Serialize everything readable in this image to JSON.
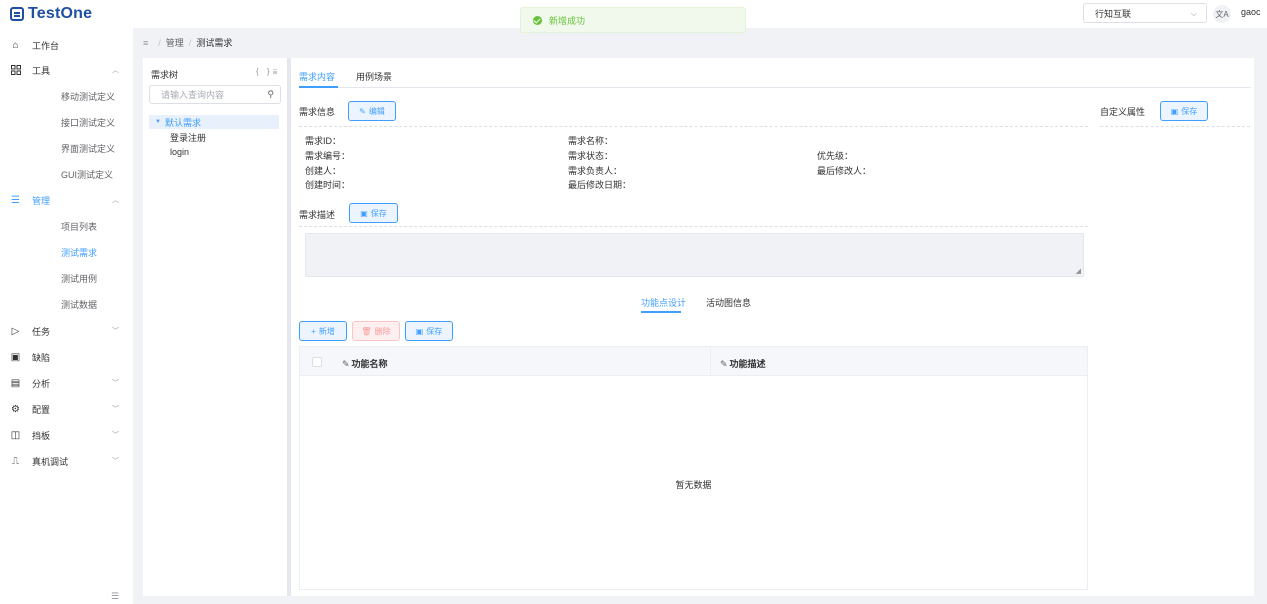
{
  "brand": {
    "name": "TestOne"
  },
  "toast": {
    "message": "新增成功",
    "color": "#67c23a"
  },
  "header": {
    "org_select": "行知互联",
    "lang_icon": "文A",
    "user": "gaoc"
  },
  "sidebar": {
    "items": [
      {
        "label": "工作台",
        "icon": "home-icon"
      },
      {
        "label": "工具",
        "icon": "grid-icon",
        "expanded": true,
        "children": [
          "移动测试定义",
          "接口测试定义",
          "界面测试定义",
          "GUI测试定义"
        ]
      },
      {
        "label": "管理",
        "icon": "list-icon",
        "expanded": true,
        "active": true,
        "children": [
          "项目列表",
          "测试需求",
          "测试用例",
          "测试数据"
        ]
      },
      {
        "label": "任务",
        "icon": "send-icon"
      },
      {
        "label": "缺陷",
        "icon": "bug-icon"
      },
      {
        "label": "分析",
        "icon": "calendar-icon"
      },
      {
        "label": "配置",
        "icon": "gear-icon"
      },
      {
        "label": "挡板",
        "icon": "panel-icon"
      },
      {
        "label": "真机调试",
        "icon": "device-icon"
      }
    ],
    "active_child": "测试需求"
  },
  "breadcrumb": [
    "管理",
    "测试需求"
  ],
  "tree": {
    "title": "需求树",
    "search_placeholder": "请输入查询内容",
    "root": "默认需求",
    "children": [
      "登录注册",
      "login"
    ]
  },
  "tabs": [
    "需求内容",
    "用例场景"
  ],
  "requirement_info": {
    "label": "需求信息",
    "edit_label": "编辑",
    "fields": {
      "id": "需求ID：",
      "name": "需求名称：",
      "number": "需求编号：",
      "status": "需求状态：",
      "priority": "优先级：",
      "creator": "创建人：",
      "owner": "需求负责人：",
      "last_modifier": "最后修改人：",
      "created_time": "创建时间：",
      "last_modified_date": "最后修改日期："
    }
  },
  "custom_attrs": {
    "label": "自定义属性",
    "save_label": "保存"
  },
  "description": {
    "label": "需求描述",
    "save_label": "保存",
    "value": ""
  },
  "sub_tabs": [
    "功能点设计",
    "活动图信息"
  ],
  "toolbar": {
    "add_label": "新增",
    "delete_label": "删除",
    "save_label": "保存"
  },
  "table": {
    "columns": [
      "功能名称",
      "功能描述"
    ],
    "empty_text": "暂无数据"
  },
  "colors": {
    "accent": "#409eff",
    "success": "#67c23a",
    "danger": "#f56c6c"
  }
}
